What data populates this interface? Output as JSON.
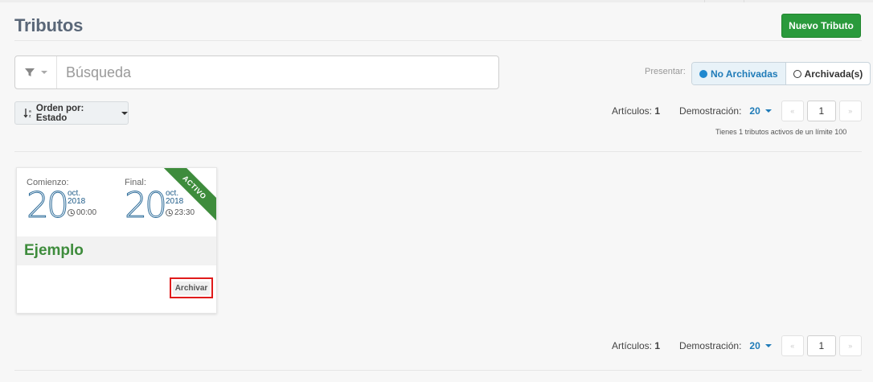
{
  "header": {
    "title": "Tributos",
    "new_button": "Nuevo Tributo"
  },
  "search": {
    "placeholder": "Búsqueda"
  },
  "filter_view": {
    "label": "Presentar:",
    "options": [
      {
        "label": "No Archivadas",
        "active": true
      },
      {
        "label": "Archivada(s)",
        "active": false
      }
    ]
  },
  "sort": {
    "label": "Orden por: Estado"
  },
  "pagination": {
    "articles_label": "Artículos:",
    "articles_count": "1",
    "demo_label": "Demostración:",
    "per_page": "20",
    "page": "1",
    "prev_glyph": "«",
    "next_glyph": "»"
  },
  "limit_text": "Tienes 1 tributos activos de un límite 100",
  "cards": [
    {
      "name": "Ejemplo",
      "status": "ACTIVO",
      "start": {
        "label": "Comienzo:",
        "day": "20",
        "month": "oct.",
        "year": "2018",
        "time": "00:00"
      },
      "end": {
        "label": "Final:",
        "day": "20",
        "month": "oct.",
        "year": "2018",
        "time": "23:30"
      },
      "archive_button": "Archivar"
    }
  ],
  "colors": {
    "accent_green": "#2a9a3c",
    "name_green": "#3e8c3c",
    "link_blue": "#1f7bb8",
    "highlight_red": "#e01b1b"
  }
}
